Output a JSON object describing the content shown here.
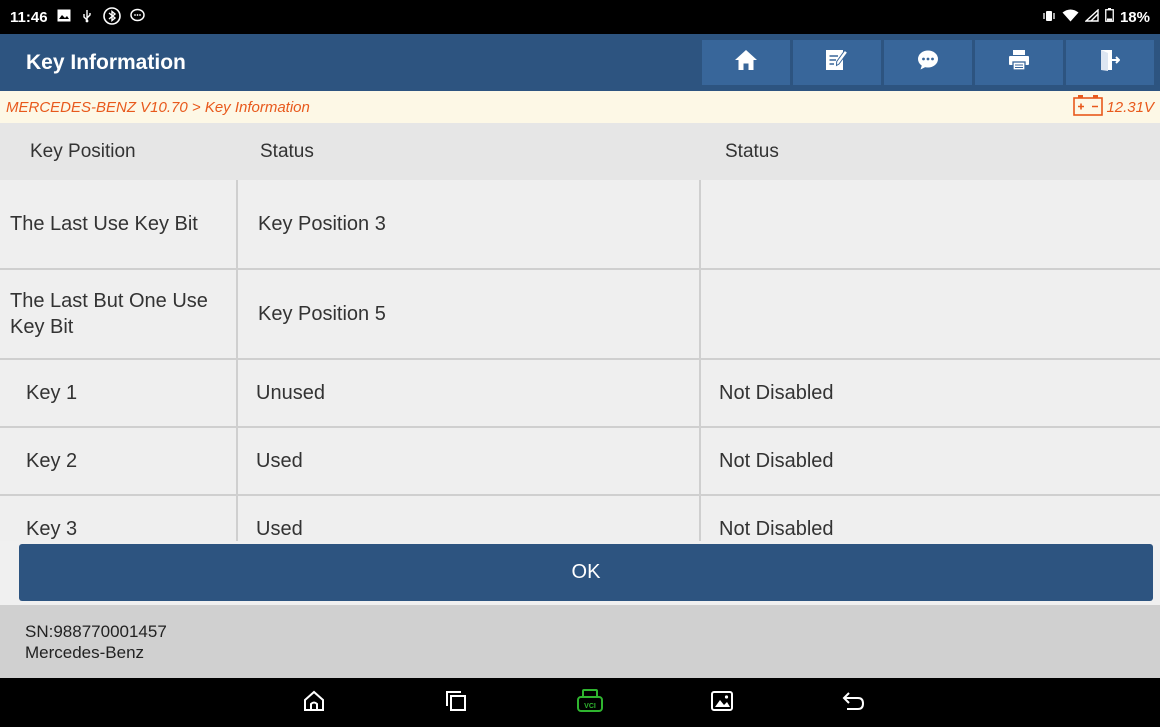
{
  "status_bar": {
    "time": "11:46",
    "battery": "18%",
    "left_icons": [
      "gallery-icon",
      "usb-icon",
      "bluetooth-icon",
      "chat-icon"
    ],
    "right_icons": [
      "vibrate-icon",
      "wifi-icon",
      "signal-icon",
      "battery-icon"
    ]
  },
  "header": {
    "title": "Key Information",
    "buttons": [
      "home-icon",
      "edit-icon",
      "message-icon",
      "print-icon",
      "exit-icon"
    ]
  },
  "breadcrumb": {
    "path": "MERCEDES-BENZ V10.70 > Key Information",
    "voltage": "12.31V"
  },
  "table": {
    "headers": [
      "Key Position",
      "Status",
      "Status"
    ],
    "rows": [
      [
        "The Last Use Key Bit",
        "Key Position 3",
        ""
      ],
      [
        "The Last But One Use Key Bit",
        "Key Position 5",
        ""
      ],
      [
        "Key 1",
        "Unused",
        "Not Disabled"
      ],
      [
        "Key 2",
        "Used",
        "Not Disabled"
      ],
      [
        "Key 3",
        "Used",
        "Not Disabled"
      ]
    ]
  },
  "ok_button": {
    "label": "OK"
  },
  "footer": {
    "serial": "SN:988770001457",
    "make": "Mercedes-Benz"
  },
  "colors": {
    "title_bar": "#2d5480",
    "toolbar_button": "#38669a",
    "breadcrumb_text": "#e8591c",
    "vci_icon": "#2fb52f"
  },
  "nav_bar": [
    "nav-home-icon",
    "recent-apps-icon",
    "vci-icon",
    "screenshot-icon",
    "back-icon"
  ]
}
